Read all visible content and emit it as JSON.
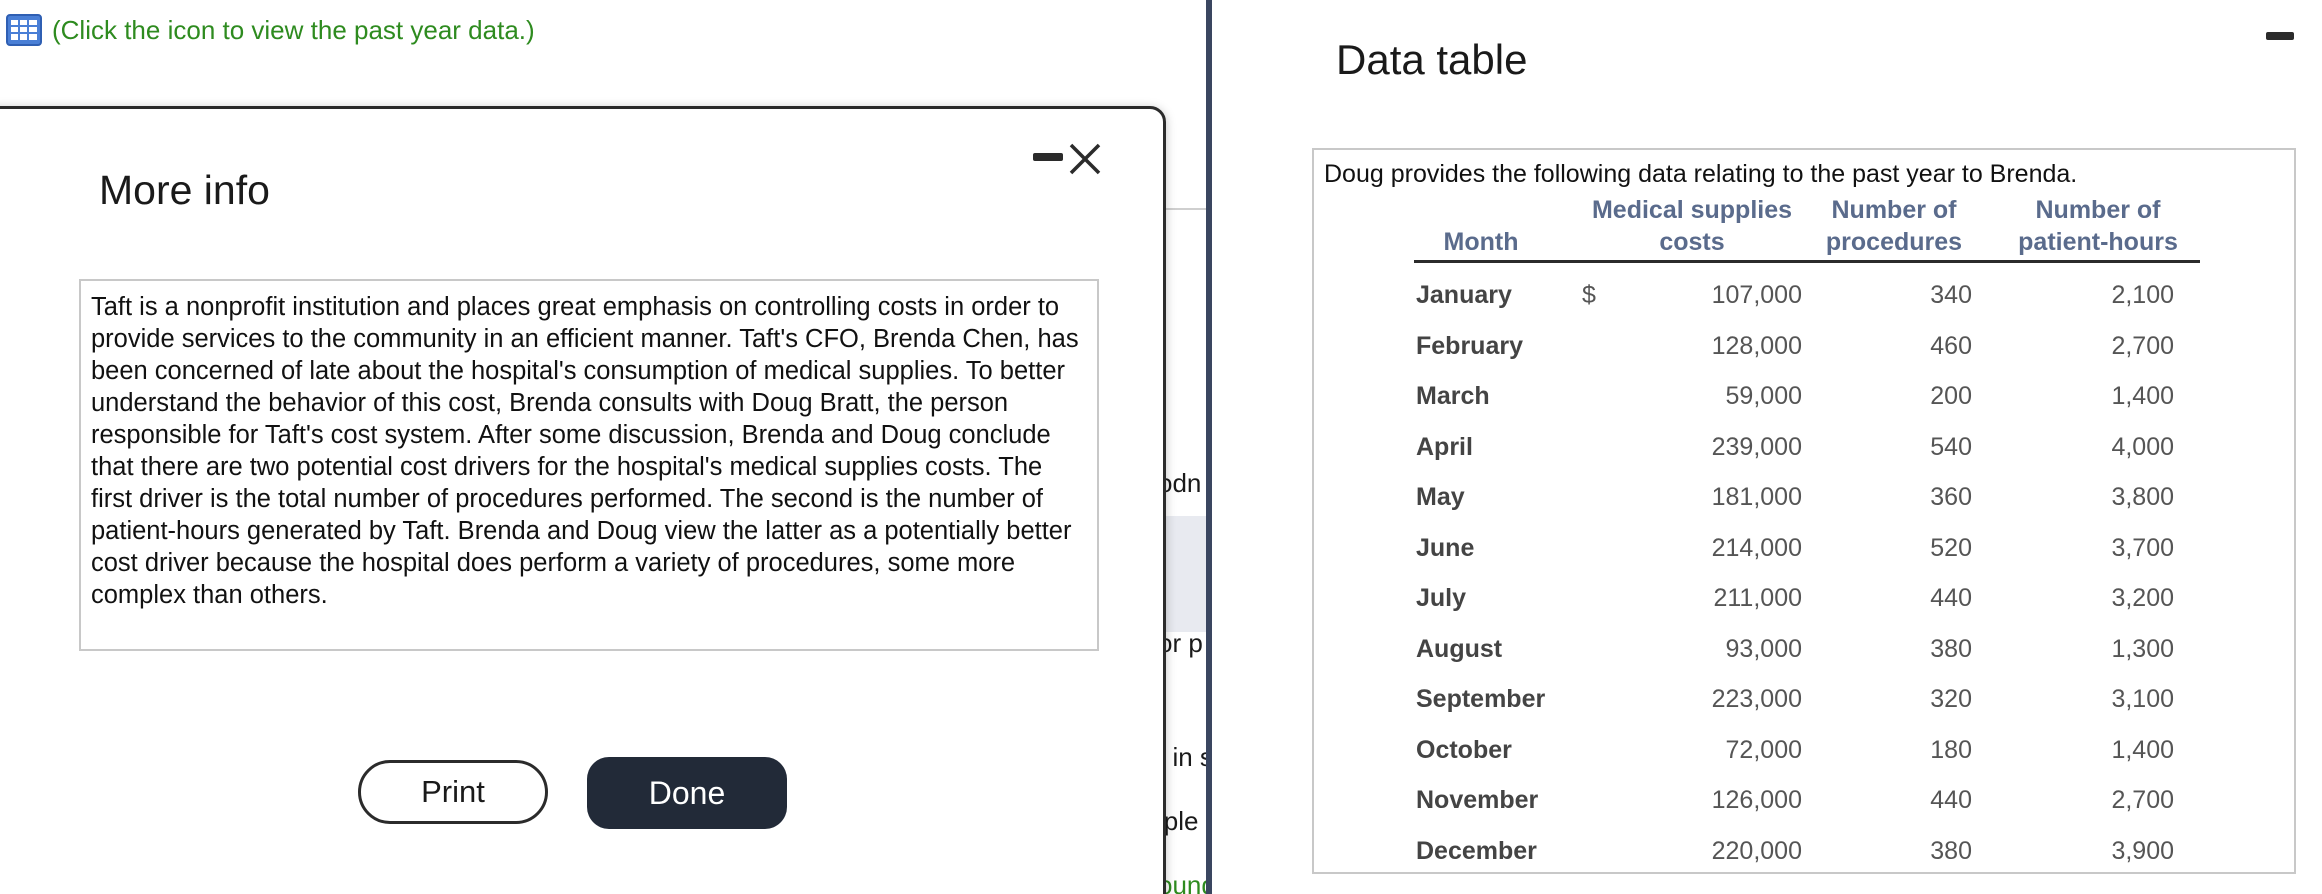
{
  "background": {
    "link_text": "(Click the icon to view the past year data.)",
    "fragments": [
      "odn",
      "or p",
      "t in s",
      "iple",
      "ound"
    ]
  },
  "more_info": {
    "title": "More info",
    "body": "Taft is a nonprofit institution and places great emphasis on controlling costs in order to provide services to the community in an efficient manner. Taft's CFO, Brenda Chen, has been concerned of late about the hospital's consumption of medical supplies. To better understand the behavior of this cost, Brenda consults with Doug Bratt, the person responsible for Taft's cost system. After some discussion, Brenda and Doug conclude that there are two potential cost drivers for the hospital's medical supplies costs. The first driver is the total number of procedures performed. The second is the number of patient-hours generated by Taft. Brenda and Doug view the latter as a potentially better cost driver because the hospital does perform a variety of procedures, some more complex than others.",
    "print_label": "Print",
    "done_label": "Done"
  },
  "data_table": {
    "title": "Data table",
    "intro": "Doug provides the following data relating to the past year to Brenda.",
    "headers": {
      "month": "Month",
      "costs_line1": "Medical supplies",
      "costs_line2": "costs",
      "procs_line1": "Number of",
      "procs_line2": "procedures",
      "hours_line1": "Number of",
      "hours_line2": "patient-hours"
    },
    "currency_symbol": "$",
    "rows": [
      {
        "month": "January",
        "costs": "107,000",
        "procedures": "340",
        "hours": "2,100"
      },
      {
        "month": "February",
        "costs": "128,000",
        "procedures": "460",
        "hours": "2,700"
      },
      {
        "month": "March",
        "costs": "59,000",
        "procedures": "200",
        "hours": "1,400"
      },
      {
        "month": "April",
        "costs": "239,000",
        "procedures": "540",
        "hours": "4,000"
      },
      {
        "month": "May",
        "costs": "181,000",
        "procedures": "360",
        "hours": "3,800"
      },
      {
        "month": "June",
        "costs": "214,000",
        "procedures": "520",
        "hours": "3,700"
      },
      {
        "month": "July",
        "costs": "211,000",
        "procedures": "440",
        "hours": "3,200"
      },
      {
        "month": "August",
        "costs": "93,000",
        "procedures": "380",
        "hours": "1,300"
      },
      {
        "month": "September",
        "costs": "223,000",
        "procedures": "320",
        "hours": "3,100"
      },
      {
        "month": "October",
        "costs": "72,000",
        "procedures": "180",
        "hours": "1,400"
      },
      {
        "month": "November",
        "costs": "126,000",
        "procedures": "440",
        "hours": "2,700"
      },
      {
        "month": "December",
        "costs": "220,000",
        "procedures": "380",
        "hours": "3,900"
      }
    ]
  },
  "colors": {
    "link_green": "#2e8b1f",
    "header_blue": "#5a6b8c",
    "done_button": "#222a38"
  }
}
